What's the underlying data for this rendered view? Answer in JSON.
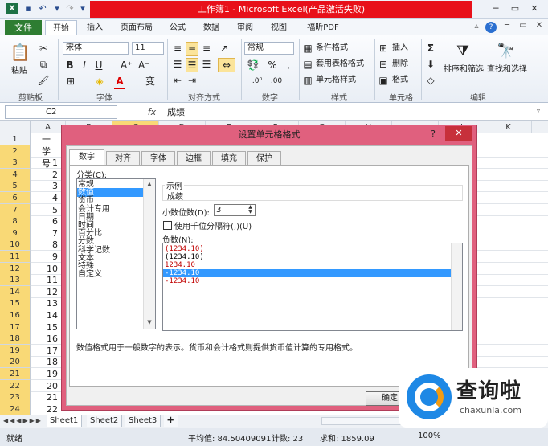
{
  "window": {
    "title": "工作簿1 - Microsoft Excel(产品激活失败)",
    "quick_access": [
      "save-icon",
      "undo-icon",
      "redo-icon"
    ],
    "controls": [
      "minimize",
      "maximize",
      "close"
    ]
  },
  "ribbon": {
    "file_tab": "文件",
    "tabs": [
      "开始",
      "插入",
      "页面布局",
      "公式",
      "数据",
      "审阅",
      "视图",
      "福昕PDF"
    ],
    "active_tab": "开始",
    "clipboard": {
      "paste": "粘贴",
      "label": "剪贴板"
    },
    "font": {
      "name": "宋体",
      "size": "11",
      "label": "字体",
      "bold": "B",
      "italic": "I",
      "underline": "U",
      "font_color": "A",
      "phonetic": "变"
    },
    "alignment": {
      "label": "对齐方式"
    },
    "number": {
      "format": "常规",
      "label": "数字"
    },
    "styles": {
      "conditional": "条件格式",
      "table": "套用表格格式",
      "cell": "单元格样式",
      "label": "样式"
    },
    "cells": {
      "insert": "插入",
      "delete": "删除",
      "format": "格式",
      "label": "单元格"
    },
    "editing": {
      "sum": "Σ",
      "sort": "排序和筛选",
      "find": "查找和选择",
      "label": "编辑"
    }
  },
  "formula_bar": {
    "name_box": "C2",
    "fx": "fx",
    "content": "成绩"
  },
  "sheet": {
    "columns": [
      "A",
      "B",
      "C",
      "D",
      "E",
      "F",
      "G",
      "H",
      "I",
      "J",
      "K"
    ],
    "rows": [
      "1",
      "2",
      "3",
      "4",
      "5",
      "6",
      "7",
      "8",
      "9",
      "10",
      "11",
      "12",
      "13",
      "14",
      "15",
      "16",
      "17",
      "18",
      "19",
      "20",
      "21",
      "22",
      "23",
      "24"
    ],
    "col_a": [
      "一",
      "学号",
      "1",
      "2",
      "3",
      "4",
      "5",
      "6",
      "7",
      "8",
      "9",
      "10",
      "11",
      "12",
      "13",
      "14",
      "15",
      "16",
      "17",
      "18",
      "19",
      "20",
      "21",
      "22"
    ]
  },
  "sheet_tabs": [
    "Sheet1",
    "Sheet2",
    "Sheet3"
  ],
  "status": {
    "ready": "就绪",
    "average": "平均值: 84.50409091",
    "count": "计数: 23",
    "sum": "求和: 1859.09",
    "zoom": "100%"
  },
  "dialog": {
    "title": "设置单元格格式",
    "help": "?",
    "tabs": [
      "数字",
      "对齐",
      "字体",
      "边框",
      "填充",
      "保护"
    ],
    "active_tab": "数字",
    "category_label": "分类(C):",
    "categories": [
      "常规",
      "数值",
      "货币",
      "会计专用",
      "日期",
      "时间",
      "百分比",
      "分数",
      "科学记数",
      "文本",
      "特殊",
      "自定义"
    ],
    "selected_category": "数值",
    "sample_label": "示例",
    "sample_value": "成绩",
    "decimal_label": "小数位数(D):",
    "decimal_value": "3",
    "thousands_label": "使用千位分隔符(,)(U)",
    "thousands_checked": false,
    "negative_label": "负数(N):",
    "negatives": [
      "(1234.10)",
      "(1234.10)",
      "1234.10",
      "-1234.10",
      "-1234.10"
    ],
    "negative_colors": [
      "#c00000",
      "#000000",
      "#c00000",
      "#ffffff",
      "#c00000"
    ],
    "selected_negative": 3,
    "description": "数值格式用于一般数字的表示。货币和会计格式则提供货币值计算的专用格式。",
    "ok": "确定"
  },
  "watermark": {
    "brand": "查询啦",
    "url": "chaxunla.com"
  }
}
